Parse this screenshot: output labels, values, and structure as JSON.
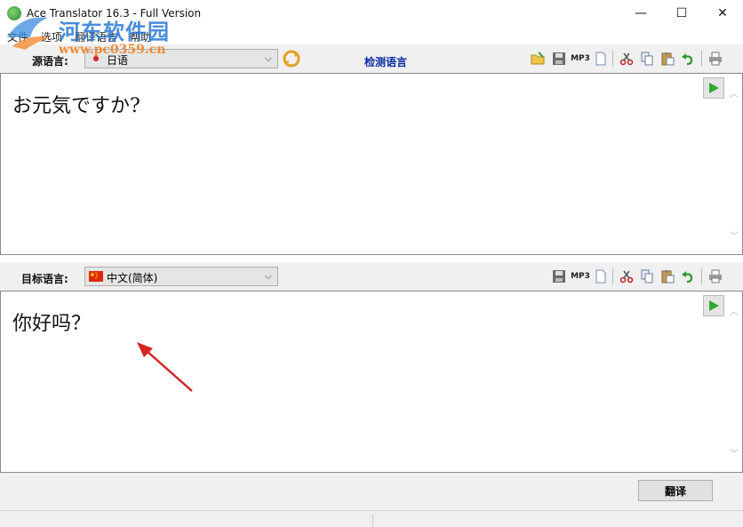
{
  "window": {
    "title": "Ace Translator 16.3 - Full Version",
    "minimize_glyph": "—",
    "maximize_glyph": "☐",
    "close_glyph": "✕"
  },
  "menu": {
    "items": [
      {
        "label": "文件"
      },
      {
        "label": "选项"
      },
      {
        "label": "翻译语言"
      },
      {
        "label": "帮助"
      }
    ]
  },
  "watermark": {
    "title": "河东软件园",
    "url": "www.pc0359.cn"
  },
  "source": {
    "label": "源语言:",
    "selected": "日语",
    "detect_label": "检测语言",
    "text": "お元気ですか?"
  },
  "target": {
    "label": "目标语言:",
    "selected": "中文(简体)",
    "text": "你好吗？"
  },
  "actions": {
    "translate_label": "翻译"
  },
  "icons": {
    "mp3_label": "MP3"
  },
  "colors": {
    "detect_link": "#0b2ea8",
    "play_green": "#2fa82f",
    "annotation_arrow": "#d42424"
  }
}
